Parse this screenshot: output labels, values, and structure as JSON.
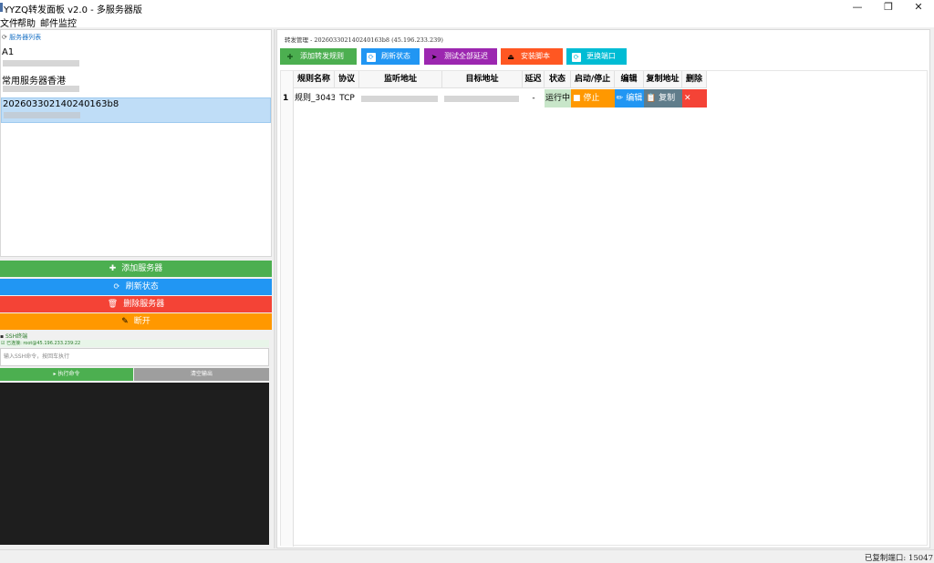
{
  "window": {
    "title": "YYZQ转发面板 v2.0 - 多服务器版",
    "controls": {
      "minimize": "—",
      "maximize": "❐",
      "close": "✕"
    }
  },
  "menu": [
    "文件",
    "帮助",
    "邮件监控"
  ],
  "sidebar": {
    "list_header": "服务器列表",
    "servers": [
      {
        "name": "A1",
        "selected": false
      },
      {
        "name": "常用服务器香港",
        "selected": false
      },
      {
        "name": "202603302140240163b8",
        "selected": true
      }
    ],
    "buttons": {
      "add_server": "添加服务器",
      "refresh_status": "刷新状态",
      "delete_server": "删除服务器",
      "disconnect": "断开"
    },
    "ssh": {
      "label": "SSH终端",
      "status": "已连接: root@45.196.233.239:22",
      "input_placeholder": "输入SSH命令，按回车执行",
      "execute": "▸ 执行命令",
      "clear": "清空输出"
    }
  },
  "main": {
    "header": "转发管理 - 202603302140240163b8 (45.196.233.239)",
    "toolbar": {
      "add_rule": "添加转发规则",
      "refresh": "刷新状态",
      "test_latency": "测试全部延迟",
      "install_script": "安装脚本",
      "change_port": "更换端口"
    },
    "table": {
      "columns": [
        "规则名称",
        "协议",
        "监听地址",
        "目标地址",
        "延迟",
        "状态",
        "启动/停止",
        "编辑",
        "复制地址",
        "删除"
      ],
      "rows": [
        {
          "index": "1",
          "name": "规则_3043",
          "protocol": "TCP",
          "latency": "-",
          "status": "运行中",
          "toggle": "■ 停止",
          "edit": "✏ 编辑",
          "copy": "📋 复制",
          "delete": "✕"
        }
      ]
    }
  },
  "statusbar": {
    "text": "已复制端口: 15047"
  },
  "colors": {
    "green": "#4caf50",
    "blue": "#2196f3",
    "red": "#f44336",
    "orange": "#ff9800",
    "purple": "#9c27b0",
    "deep_orange": "#ff5722",
    "teal": "#00bcd4",
    "selected": "#bfddf7"
  }
}
